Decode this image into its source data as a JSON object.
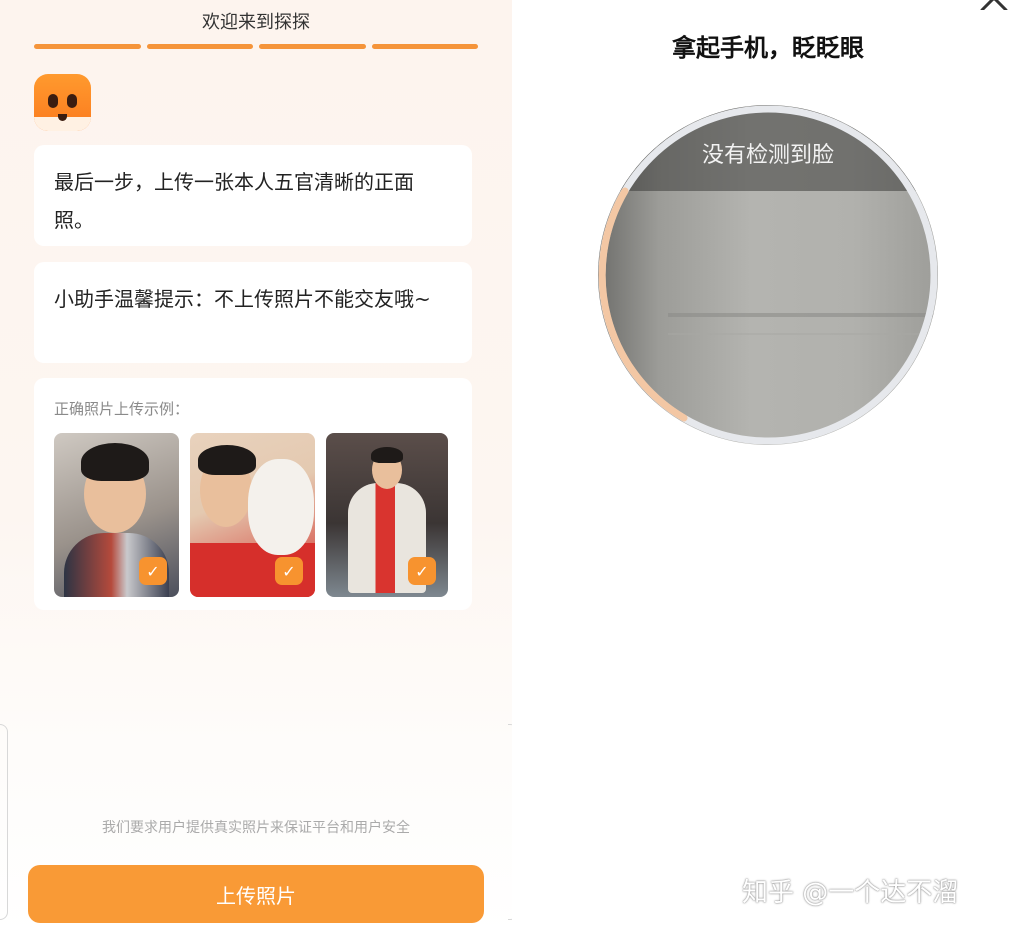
{
  "left": {
    "header_title": "欢迎来到探探",
    "progress_steps": 4,
    "messages": [
      "最后一步，上传一张本人五官清晰的正面照。",
      "小助手温馨提示：不上传照片不能交友哦~"
    ],
    "examples": {
      "label": "正确照片上传示例："
    },
    "privacy_note": "我们要求用户提供真实照片来保证平台和用户安全",
    "upload_button": "上传照片"
  },
  "right": {
    "instruction": "拿起手机，眨眨眼",
    "detect_status": "没有检测到脸",
    "watermark": "知乎 @一个达不溜"
  },
  "colors": {
    "accent": "#f99a36",
    "progress": "#f5943a",
    "check_badge": "#f7932f"
  },
  "icons": {
    "close": "close-icon",
    "check": "check-icon",
    "logo": "tantan-fox-logo"
  }
}
